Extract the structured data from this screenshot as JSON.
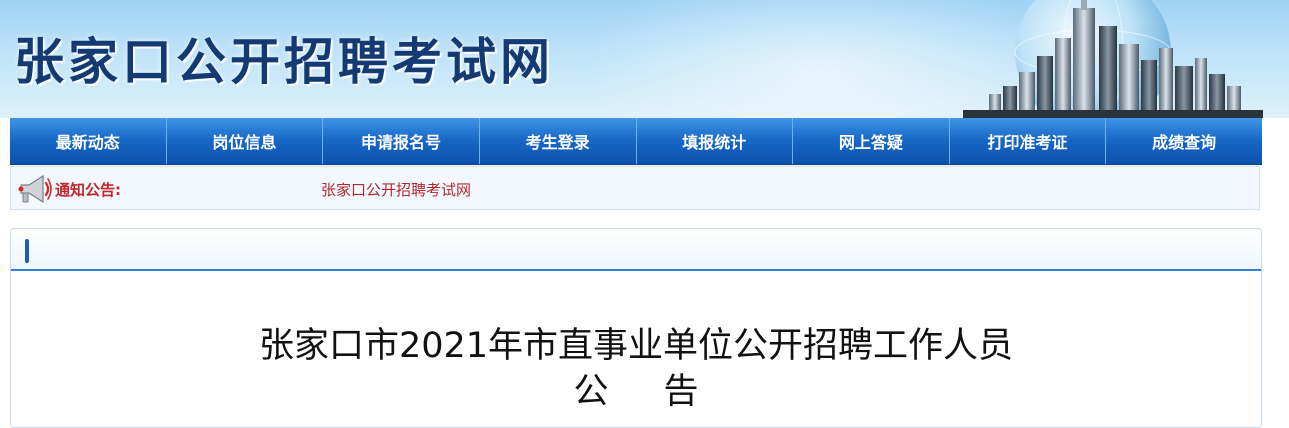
{
  "header": {
    "site_title": "张家口公开招聘考试网"
  },
  "nav": {
    "items": [
      {
        "label": "最新动态"
      },
      {
        "label": "岗位信息"
      },
      {
        "label": "申请报名号"
      },
      {
        "label": "考生登录"
      },
      {
        "label": "填报统计"
      },
      {
        "label": "网上答疑"
      },
      {
        "label": "打印准考证"
      },
      {
        "label": "成绩查询"
      }
    ]
  },
  "notice": {
    "icon": "megaphone-icon",
    "label": "通知公告:",
    "text": "张家口公开招聘考试网"
  },
  "article": {
    "title": "张家口市2021年市直事业单位公开招聘工作人员",
    "subtitle": "公告"
  },
  "colors": {
    "nav_bg": "#1767c6",
    "title_text": "#143a73",
    "notice_label": "#c0262a",
    "notice_link": "#b22a2e",
    "panel_accent": "#2f7fd3"
  }
}
